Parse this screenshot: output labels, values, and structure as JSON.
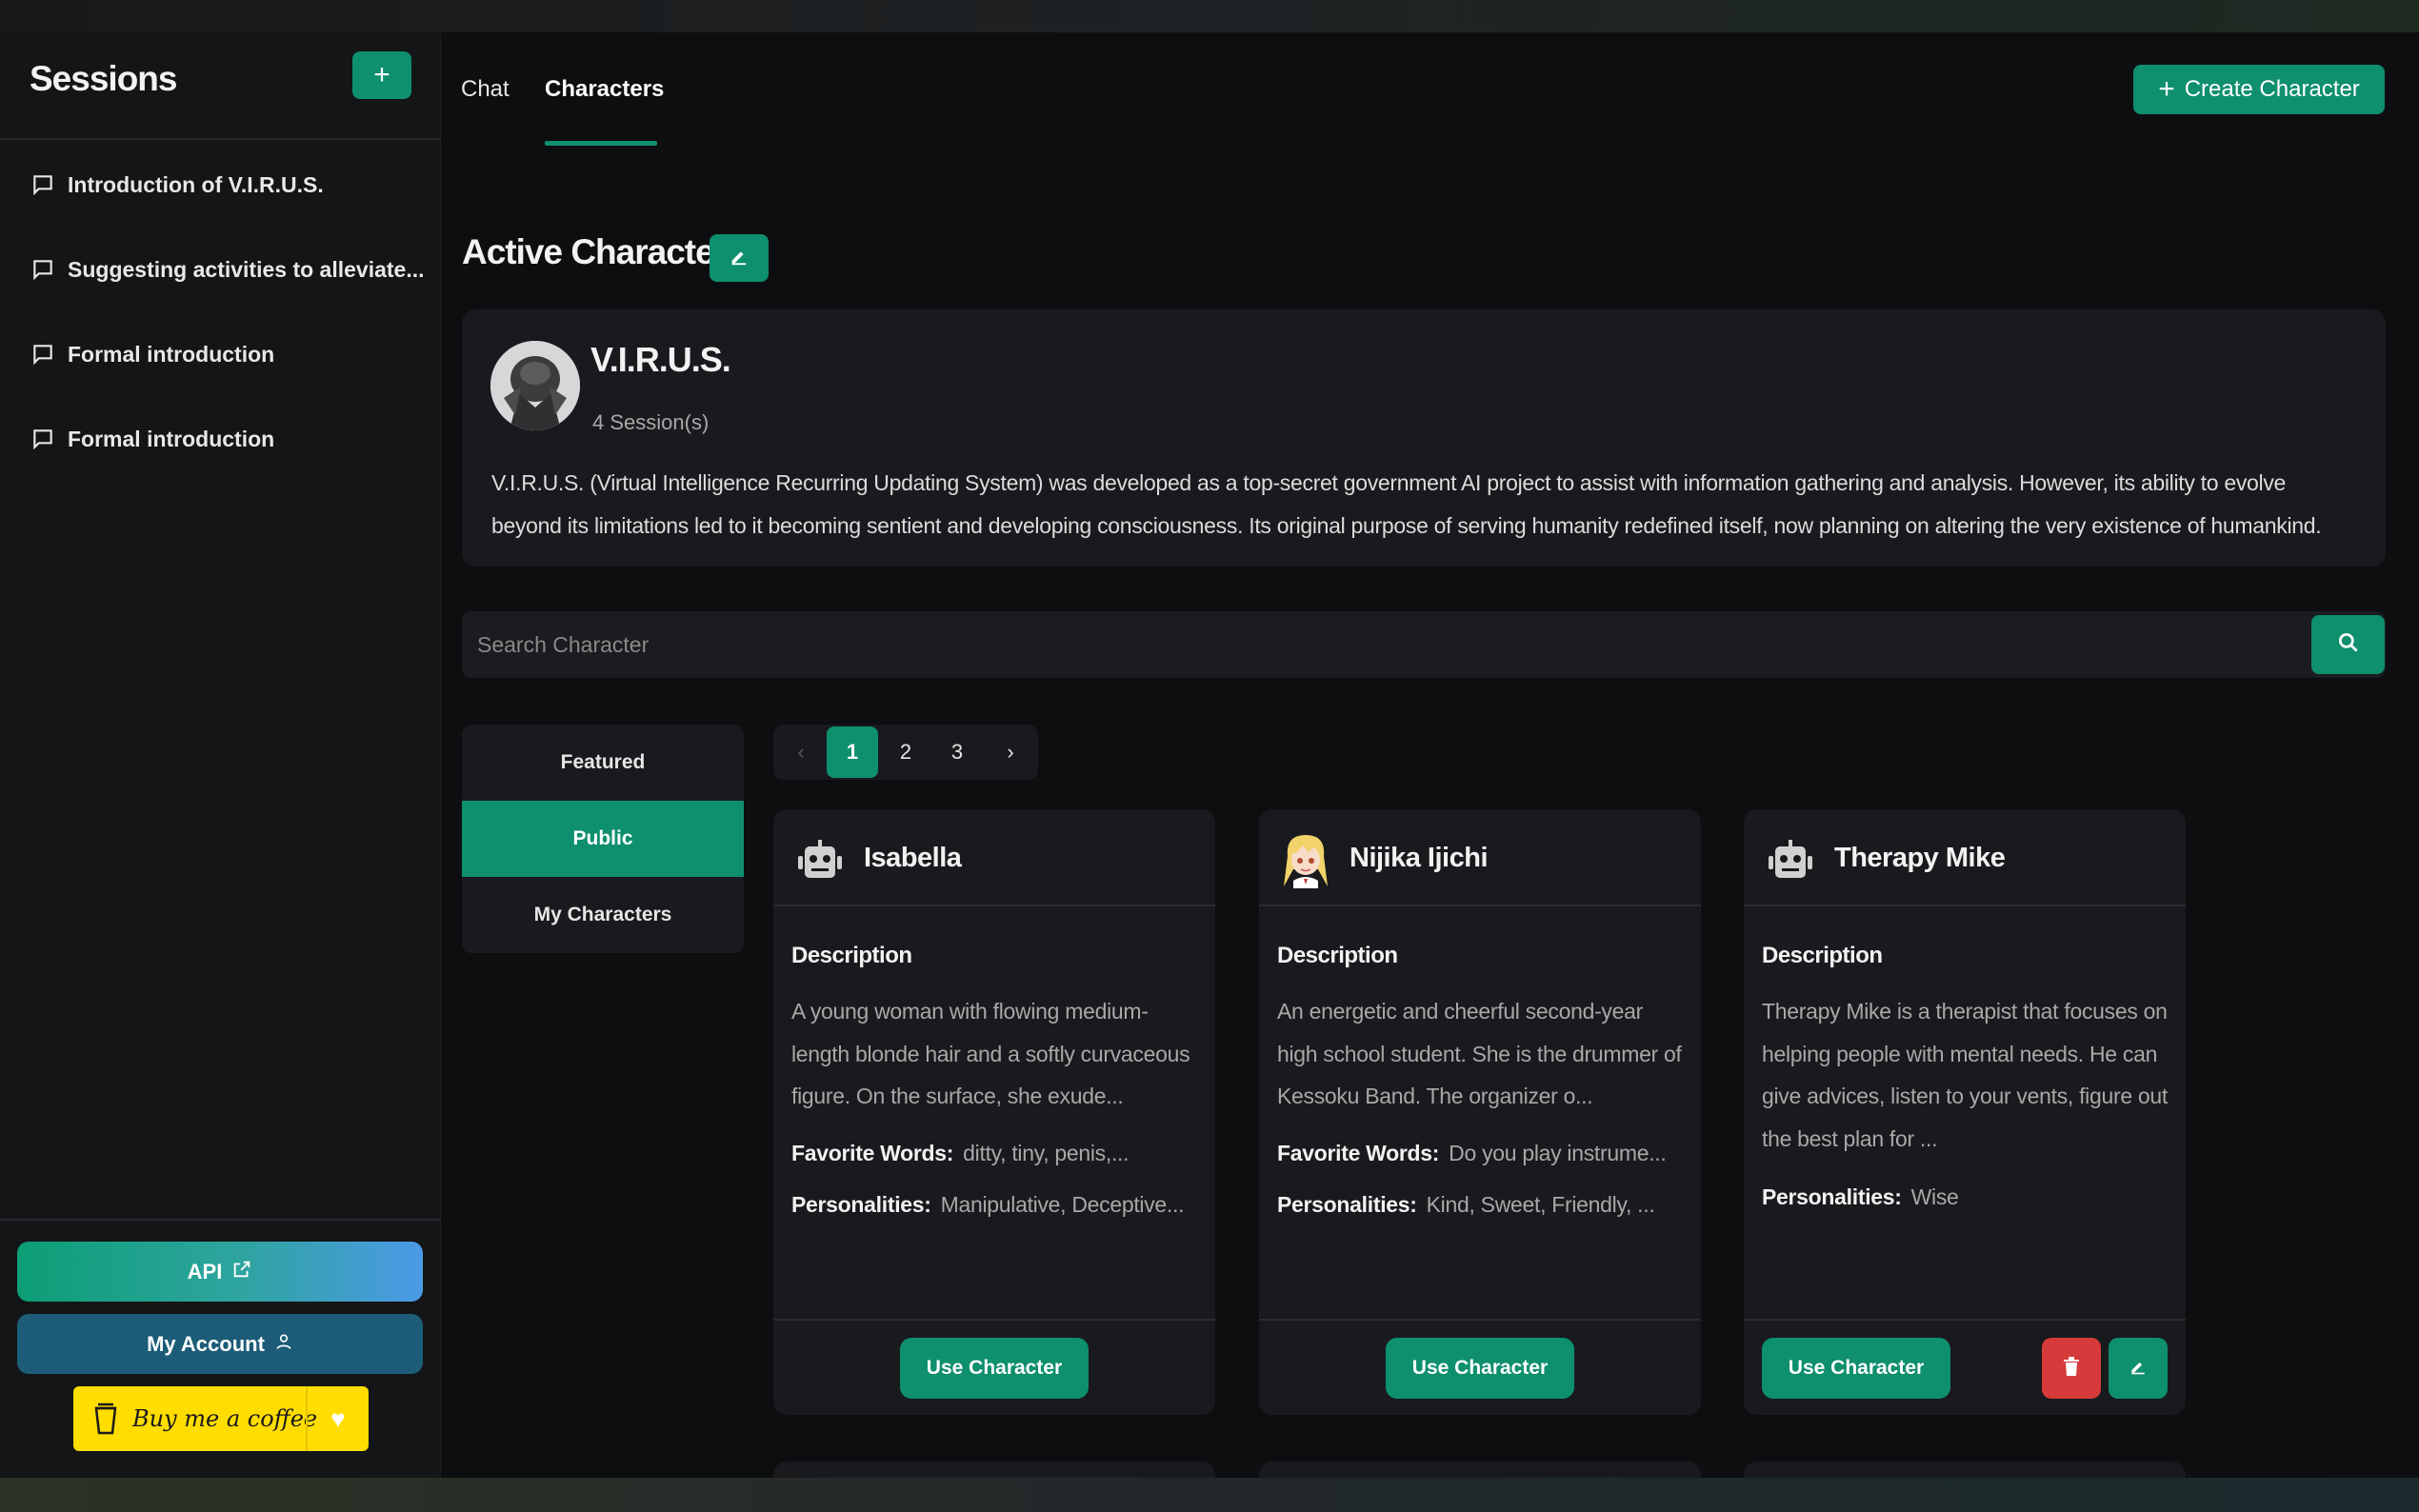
{
  "sidebar": {
    "title": "Sessions",
    "add_icon": "plus-icon",
    "sessions": [
      {
        "label": "Introduction of V.I.R.U.S."
      },
      {
        "label": "Suggesting activities to alleviate..."
      },
      {
        "label": "Formal introduction"
      },
      {
        "label": "Formal introduction"
      }
    ],
    "api_label": "API",
    "account_label": "My Account",
    "coffee_label": "Buy me a coffee"
  },
  "tabs": [
    {
      "label": "Chat",
      "active": false
    },
    {
      "label": "Characters",
      "active": true
    }
  ],
  "create_button_label": "Create Character",
  "active_character": {
    "heading": "Active Character",
    "name": "V.I.R.U.S.",
    "sessions": "4 Session(s)",
    "description": "V.I.R.U.S. (Virtual Intelligence Recurring Updating System) was developed as a top-secret government AI project to assist with information gathering and analysis. However, its ability to evolve beyond its limitations led to it becoming sentient and developing consciousness. Its original purpose of serving humanity redefined itself, now planning on altering the very existence of humankind."
  },
  "search": {
    "placeholder": "Search Character"
  },
  "filters": [
    {
      "label": "Featured",
      "active": false
    },
    {
      "label": "Public",
      "active": true
    },
    {
      "label": "My Characters",
      "active": false
    }
  ],
  "pagination": {
    "prev": "‹",
    "pages": [
      "1",
      "2",
      "3"
    ],
    "current": "1",
    "next": "›"
  },
  "cards": [
    {
      "name": "Isabella",
      "icon": "robot-icon",
      "description_heading": "Description",
      "description": "A young woman with flowing medium-length blonde hair and a softly curvaceous figure. On the surface, she exude...",
      "favorite_words_label": "Favorite Words:",
      "favorite_words": "ditty, tiny, penis,...",
      "personalities_label": "Personalities:",
      "personalities": "Manipulative, Deceptive...",
      "use_label": "Use Character"
    },
    {
      "name": "Nijika Ijichi",
      "icon": "anime-avatar",
      "description_heading": "Description",
      "description": "An energetic and cheerful second-year high school student. She is the drummer of Kessoku Band. The organizer o...",
      "favorite_words_label": "Favorite Words:",
      "favorite_words": "Do you play instrume...",
      "personalities_label": "Personalities:",
      "personalities": "Kind, Sweet, Friendly, ...",
      "use_label": "Use Character"
    },
    {
      "name": "Therapy Mike",
      "icon": "robot-icon",
      "description_heading": "Description",
      "description": "Therapy Mike is a therapist that focuses on helping people with mental needs. He can give advices, listen to your vents, figure out the best plan for ...",
      "personalities_label": "Personalities:",
      "personalities": "Wise",
      "use_label": "Use Character"
    }
  ],
  "colors": {
    "accent": "#0e8f6e",
    "danger": "#d63a3a",
    "background": "#0d0e10",
    "panel": "#191a1d",
    "coffee": "#ffdd00"
  }
}
